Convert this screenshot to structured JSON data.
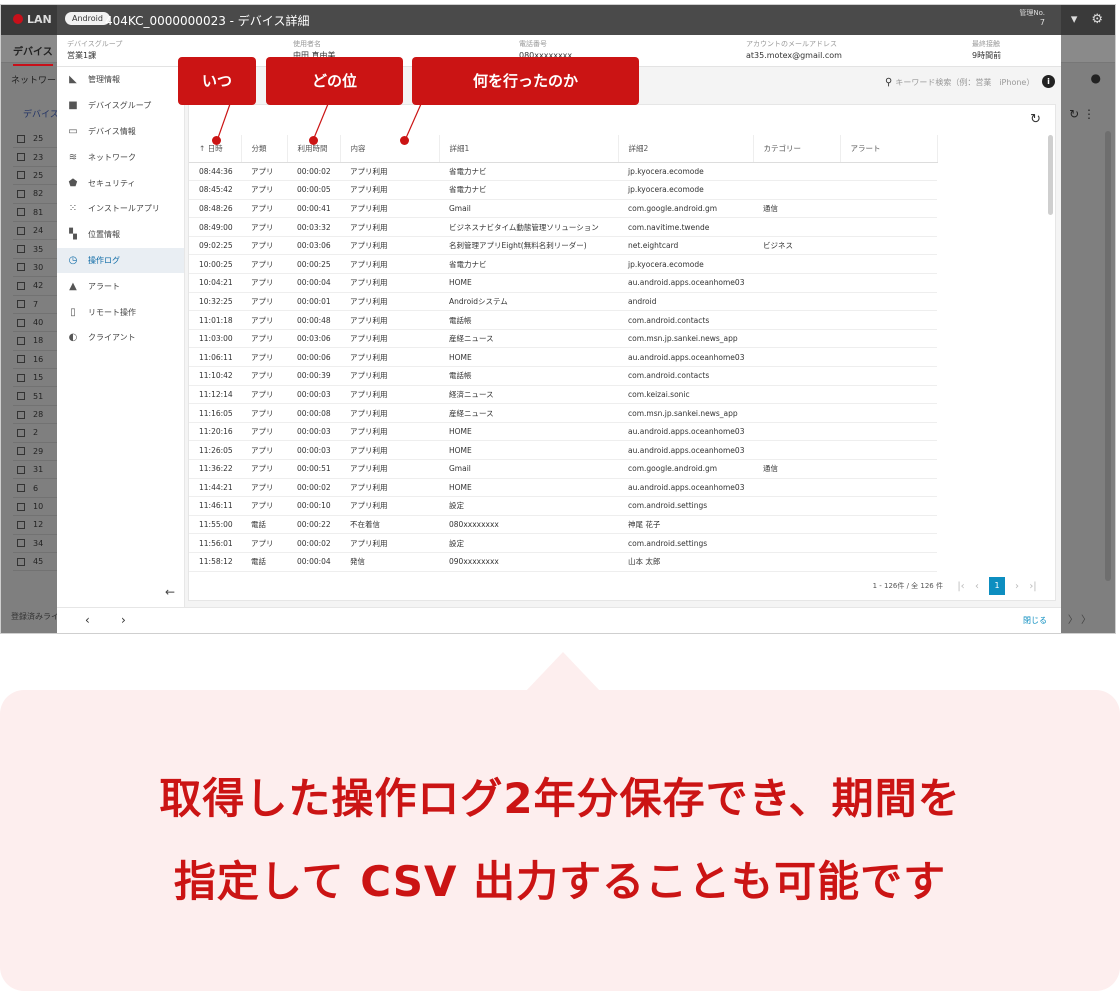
{
  "app": {
    "logo": "LAN",
    "tab": "デバイス",
    "network_label": "ネットワーク",
    "device_label": "デバイス",
    "footer_text": "登録済みライ",
    "row_numbers": [
      "25",
      "23",
      "25",
      "82",
      "81",
      "24",
      "35",
      "30",
      "42",
      "7",
      "40",
      "18",
      "16",
      "15",
      "51",
      "28",
      "2",
      "29",
      "31",
      "6",
      "10",
      "12",
      "34",
      "45"
    ]
  },
  "modal": {
    "os_chip": "Android",
    "title": "404KC_0000000023 - デバイス詳細",
    "mgmt_no_label": "管理No.",
    "mgmt_no_value": "7",
    "info": {
      "group_label": "デバイスグループ",
      "group_value": "営業1課",
      "user_label": "使用者名",
      "user_value": "中田 真由美",
      "phone_label": "電話番号",
      "phone_value": "080xxxxxxxx",
      "email_label": "アカウントのメールアドレス",
      "email_value": "at35.motex@gmail.com",
      "last_label": "最終接触",
      "last_value": "9時間前"
    },
    "sidebar": [
      {
        "label": "管理情報",
        "icon": "book-icon",
        "glyph": "◣"
      },
      {
        "label": "デバイスグループ",
        "icon": "folder-icon",
        "glyph": "■"
      },
      {
        "label": "デバイス情報",
        "icon": "devices-icon",
        "glyph": "▭"
      },
      {
        "label": "ネットワーク",
        "icon": "wifi-icon",
        "glyph": "≋"
      },
      {
        "label": "セキュリティ",
        "icon": "shield-icon",
        "glyph": "⬟"
      },
      {
        "label": "インストールアプリ",
        "icon": "apps-grid-icon",
        "glyph": "⁙"
      },
      {
        "label": "位置情報",
        "icon": "map-icon",
        "glyph": "▚"
      },
      {
        "label": "操作ログ",
        "icon": "history-icon",
        "glyph": "◷"
      },
      {
        "label": "アラート",
        "icon": "warning-icon",
        "glyph": "▲"
      },
      {
        "label": "リモート操作",
        "icon": "remote-icon",
        "glyph": "▯"
      },
      {
        "label": "クライアント",
        "icon": "client-icon",
        "glyph": "◐"
      }
    ],
    "active_index": 7,
    "search_placeholder": "キーワード検索（例：営業　iPhone）",
    "columns": [
      "日時",
      "分類",
      "利用時間",
      "内容",
      "詳細1",
      "詳細2",
      "カテゴリー",
      "アラート"
    ],
    "sort_arrow": "↑",
    "rows": [
      [
        "08:44:36",
        "アプリ",
        "00:00:02",
        "アプリ利用",
        "省電力ナビ",
        "jp.kyocera.ecomode",
        ""
      ],
      [
        "08:45:42",
        "アプリ",
        "00:00:05",
        "アプリ利用",
        "省電力ナビ",
        "jp.kyocera.ecomode",
        ""
      ],
      [
        "08:48:26",
        "アプリ",
        "00:00:41",
        "アプリ利用",
        "Gmail",
        "com.google.android.gm",
        "通信"
      ],
      [
        "08:49:00",
        "アプリ",
        "00:03:32",
        "アプリ利用",
        "ビジネスナビタイム動態管理ソリューション",
        "com.navitime.twende",
        ""
      ],
      [
        "09:02:25",
        "アプリ",
        "00:03:06",
        "アプリ利用",
        "名刺管理アプリEight(無料名刺リーダー)",
        "net.eightcard",
        "ビジネス"
      ],
      [
        "10:00:25",
        "アプリ",
        "00:00:25",
        "アプリ利用",
        "省電力ナビ",
        "jp.kyocera.ecomode",
        ""
      ],
      [
        "10:04:21",
        "アプリ",
        "00:00:04",
        "アプリ利用",
        "HOME",
        "au.android.apps.oceanhome03",
        ""
      ],
      [
        "10:32:25",
        "アプリ",
        "00:00:01",
        "アプリ利用",
        "Androidシステム",
        "android",
        ""
      ],
      [
        "11:01:18",
        "アプリ",
        "00:00:48",
        "アプリ利用",
        "電話帳",
        "com.android.contacts",
        ""
      ],
      [
        "11:03:00",
        "アプリ",
        "00:03:06",
        "アプリ利用",
        "産経ニュース",
        "com.msn.jp.sankei.news_app",
        ""
      ],
      [
        "11:06:11",
        "アプリ",
        "00:00:06",
        "アプリ利用",
        "HOME",
        "au.android.apps.oceanhome03",
        ""
      ],
      [
        "11:10:42",
        "アプリ",
        "00:00:39",
        "アプリ利用",
        "電話帳",
        "com.android.contacts",
        ""
      ],
      [
        "11:12:14",
        "アプリ",
        "00:00:03",
        "アプリ利用",
        "経済ニュース",
        "com.keizai.sonic",
        ""
      ],
      [
        "11:16:05",
        "アプリ",
        "00:00:08",
        "アプリ利用",
        "産経ニュース",
        "com.msn.jp.sankei.news_app",
        ""
      ],
      [
        "11:20:16",
        "アプリ",
        "00:00:03",
        "アプリ利用",
        "HOME",
        "au.android.apps.oceanhome03",
        ""
      ],
      [
        "11:26:05",
        "アプリ",
        "00:00:03",
        "アプリ利用",
        "HOME",
        "au.android.apps.oceanhome03",
        ""
      ],
      [
        "11:36:22",
        "アプリ",
        "00:00:51",
        "アプリ利用",
        "Gmail",
        "com.google.android.gm",
        "通信"
      ],
      [
        "11:44:21",
        "アプリ",
        "00:00:02",
        "アプリ利用",
        "HOME",
        "au.android.apps.oceanhome03",
        ""
      ],
      [
        "11:46:11",
        "アプリ",
        "00:00:10",
        "アプリ利用",
        "設定",
        "com.android.settings",
        ""
      ],
      [
        "11:55:00",
        "電話",
        "00:00:22",
        "不在着信",
        "080xxxxxxxx",
        "神尾 花子",
        ""
      ],
      [
        "11:56:01",
        "アプリ",
        "00:00:02",
        "アプリ利用",
        "設定",
        "com.android.settings",
        ""
      ],
      [
        "11:58:12",
        "電話",
        "00:00:04",
        "発信",
        "090xxxxxxxx",
        "山本 太郎",
        ""
      ]
    ],
    "pager": {
      "range": "1 - 126件 / 全 126 件",
      "current": "1"
    },
    "close_label": "閉じる"
  },
  "callouts": {
    "when": "いつ",
    "which": "どの位",
    "what": "何を行ったのか"
  },
  "headline": {
    "line1": "取得した操作ログ2年分保存でき、期間を",
    "line2": "指定して CSV 出力することも可能です"
  },
  "colors": {
    "accent_red": "#cb1414",
    "link_blue": "#0d8ec0",
    "speech_bg": "#fdeeee"
  }
}
